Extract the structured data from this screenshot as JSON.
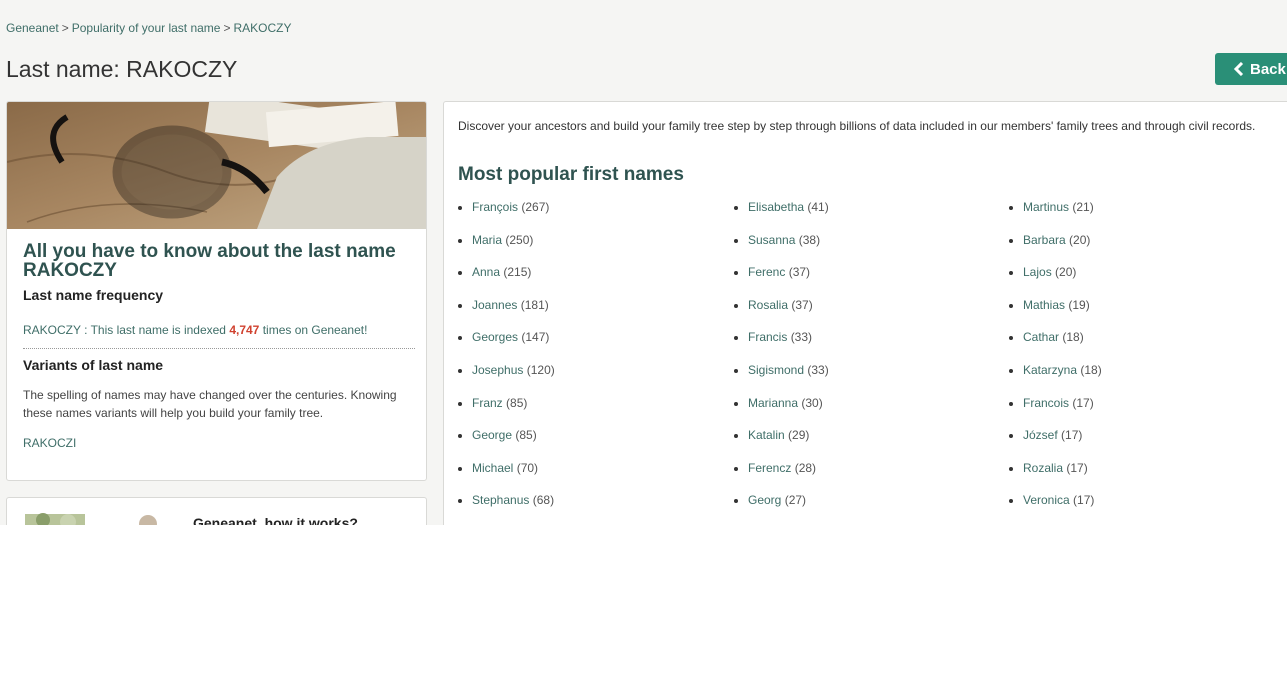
{
  "breadcrumb": {
    "items": [
      "Geneanet",
      "Popularity of your last name",
      "RAKOCZY"
    ],
    "separator": ">"
  },
  "page_title": "Last name: RAKOCZY",
  "back_button": {
    "label": "Back",
    "icon": "chevron-left-icon"
  },
  "left_card": {
    "heading_line1": "All you have to know about the last name",
    "heading_line2": "RAKOCZY",
    "frequency_title": "Last name frequency",
    "frequency_name": "RAKOCZY",
    "frequency_text_before": " : This last name is indexed ",
    "frequency_count": "4,747",
    "frequency_text_after": " times on Geneanet!",
    "variants_title": "Variants of last name",
    "variants_text": "The spelling of names may have changed over the centuries. Knowing these names variants will help you build your family tree.",
    "variant": "RAKOCZI"
  },
  "left_card2": {
    "title": "Geneanet, how it works?"
  },
  "right_card": {
    "intro": "Discover your ancestors and build your family tree step by step through billions of data included in our members' family trees and through civil records.",
    "names_title": "Most popular first names",
    "columns": [
      [
        {
          "name": "François",
          "count": "(267)"
        },
        {
          "name": "Maria",
          "count": "(250)"
        },
        {
          "name": "Anna",
          "count": "(215)"
        },
        {
          "name": "Joannes",
          "count": "(181)"
        },
        {
          "name": "Georges",
          "count": "(147)"
        },
        {
          "name": "Josephus",
          "count": "(120)"
        },
        {
          "name": "Franz",
          "count": "(85)"
        },
        {
          "name": "George",
          "count": "(85)"
        },
        {
          "name": "Michael",
          "count": "(70)"
        },
        {
          "name": "Stephanus",
          "count": "(68)"
        }
      ],
      [
        {
          "name": "Elisabetha",
          "count": "(41)"
        },
        {
          "name": "Susanna",
          "count": "(38)"
        },
        {
          "name": "Ferenc",
          "count": "(37)"
        },
        {
          "name": "Rosalia",
          "count": "(37)"
        },
        {
          "name": "Francis",
          "count": "(33)"
        },
        {
          "name": "Sigismond",
          "count": "(33)"
        },
        {
          "name": "Marianna",
          "count": "(30)"
        },
        {
          "name": "Katalin",
          "count": "(29)"
        },
        {
          "name": "Ferencz",
          "count": "(28)"
        },
        {
          "name": "Georg",
          "count": "(27)"
        }
      ],
      [
        {
          "name": "Martinus",
          "count": "(21)"
        },
        {
          "name": "Barbara",
          "count": "(20)"
        },
        {
          "name": "Lajos",
          "count": "(20)"
        },
        {
          "name": "Mathias",
          "count": "(19)"
        },
        {
          "name": "Cathar",
          "count": "(18)"
        },
        {
          "name": "Katarzyna",
          "count": "(18)"
        },
        {
          "name": "Francois",
          "count": "(17)"
        },
        {
          "name": "József",
          "count": "(17)"
        },
        {
          "name": "Rozalia",
          "count": "(17)"
        },
        {
          "name": "Veronica",
          "count": "(17)"
        }
      ]
    ]
  },
  "colors": {
    "accent": "#2a8f77",
    "link": "#3f6e68",
    "heading": "#2f5350",
    "highlight": "#d0412f"
  }
}
